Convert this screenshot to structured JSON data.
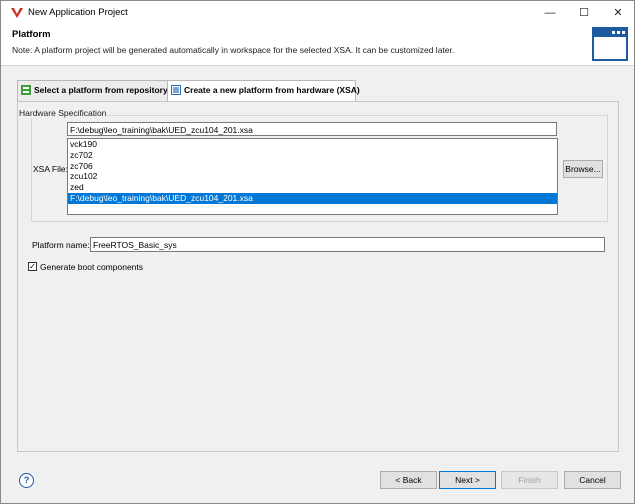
{
  "window": {
    "title": "New Application Project",
    "minimize": "—",
    "maximize": "☐",
    "close": "✕"
  },
  "header": {
    "title": "Platform",
    "note": "Note: A platform project will be generated automatically in workspace for the selected XSA. It can be customized later."
  },
  "tabs": [
    {
      "label": "Select a platform from repository",
      "active": false
    },
    {
      "label": "Create a new platform from hardware (XSA)",
      "active": true
    }
  ],
  "hardware": {
    "group_label": "Hardware Specification",
    "xsa_label": "XSA File:",
    "xsa_value": "F:\\debug\\leo_training\\bak\\UED_zcu104_201.xsa",
    "options": [
      "vck190",
      "zc702",
      "zc706",
      "zcu102",
      "zed",
      "F:\\debug\\leo_training\\bak\\UED_zcu104_201.xsa"
    ],
    "selected_index": 5,
    "browse_label": "Browse..."
  },
  "platform": {
    "name_label": "Platform name:",
    "name_value": "FreeRTOS_Basic_sys",
    "boot_label": "Generate boot components",
    "boot_checked": true
  },
  "footer": {
    "help": "?",
    "back": "< Back",
    "next": "Next >",
    "finish": "Finish",
    "cancel": "Cancel"
  },
  "colors": {
    "accent": "#0078d7",
    "header_icon": "#1e5aa0",
    "brand": "#d42a20"
  }
}
